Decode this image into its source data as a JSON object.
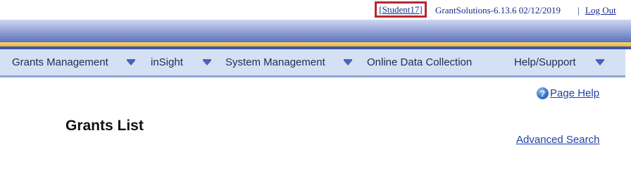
{
  "header": {
    "user_label": "[Student17]",
    "version_date": "GrantSolutions-6.13.6  02/12/2019",
    "separator": "|",
    "logout_label": "Log Out"
  },
  "nav": {
    "items": [
      {
        "label": "Grants Management",
        "has_dropdown": true
      },
      {
        "label": "inSight",
        "has_dropdown": true
      },
      {
        "label": "System Management",
        "has_dropdown": true
      },
      {
        "label": "Online Data Collection",
        "has_dropdown": false
      },
      {
        "label": "Help/Support",
        "has_dropdown": true
      }
    ]
  },
  "main": {
    "help_icon": "?",
    "help_label": "Page Help",
    "title": "Grants List",
    "advanced_search_label": "Advanced Search"
  },
  "colors": {
    "nav_background": "#d4e0f3",
    "accent_gold": "#e7b635",
    "highlight_border": "#b5282f",
    "link": "#1e3fa6"
  }
}
